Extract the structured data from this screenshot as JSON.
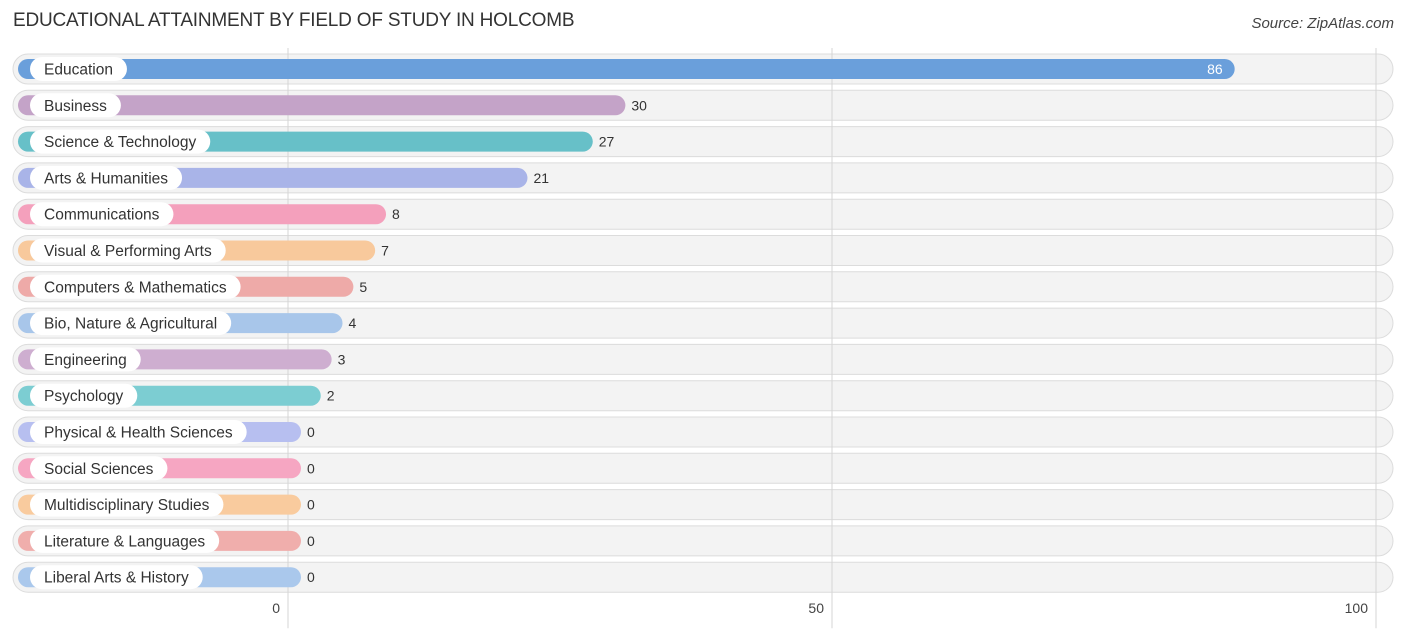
{
  "header": {
    "title": "EDUCATIONAL ATTAINMENT BY FIELD OF STUDY IN HOLCOMB",
    "source": "Source: ZipAtlas.com"
  },
  "chart_data": {
    "type": "bar",
    "orientation": "horizontal",
    "title": "EDUCATIONAL ATTAINMENT BY FIELD OF STUDY IN HOLCOMB",
    "xlabel": "",
    "ylabel": "",
    "xlim": [
      0,
      100
    ],
    "xticks": [
      0,
      50,
      100
    ],
    "xtick_labels": [
      "0",
      "50",
      "100"
    ],
    "grid": true,
    "categories": [
      "Education",
      "Business",
      "Science & Technology",
      "Arts & Humanities",
      "Communications",
      "Visual & Performing Arts",
      "Computers & Mathematics",
      "Bio, Nature & Agricultural",
      "Engineering",
      "Psychology",
      "Physical & Health Sciences",
      "Social Sciences",
      "Multidisciplinary Studies",
      "Literature & Languages",
      "Liberal Arts & History"
    ],
    "values": [
      86,
      30,
      27,
      21,
      8,
      7,
      5,
      4,
      3,
      2,
      0,
      0,
      0,
      0,
      0
    ],
    "colors": [
      "#6a9fdb",
      "#c4a3c8",
      "#67c0c8",
      "#a9b4e8",
      "#f4a0bc",
      "#f8c99c",
      "#eeaaa8",
      "#a8c6ea",
      "#ceaed0",
      "#7ccdd2",
      "#b7bff0",
      "#f6a6c2",
      "#f9cb9e",
      "#f0aeac",
      "#aac8ec"
    ],
    "value_labels": [
      "86",
      "30",
      "27",
      "21",
      "8",
      "7",
      "5",
      "4",
      "3",
      "2",
      "0",
      "0",
      "0",
      "0",
      "0"
    ]
  }
}
